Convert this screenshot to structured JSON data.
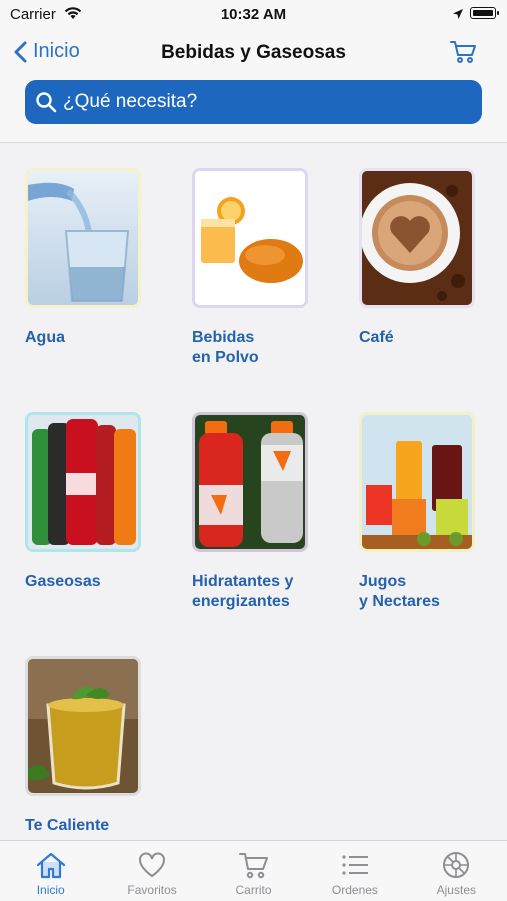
{
  "status_bar": {
    "carrier": "Carrier",
    "time": "10:32 AM"
  },
  "nav": {
    "back_label": "Inicio",
    "title": "Bebidas y Gaseosas"
  },
  "search": {
    "placeholder": "¿Qué necesita?"
  },
  "categories": [
    {
      "line1": "Agua",
      "line2": ""
    },
    {
      "line1": "Bebidas",
      "line2": "en Polvo"
    },
    {
      "line1": "Café",
      "line2": ""
    },
    {
      "line1": "Gaseosas",
      "line2": ""
    },
    {
      "line1": "Hidratantes y",
      "line2": "energizantes"
    },
    {
      "line1": "Jugos",
      "line2": "y Nectares"
    },
    {
      "line1": "Te Caliente",
      "line2": ""
    }
  ],
  "tabbar": {
    "tabs": [
      {
        "label": "Inicio",
        "icon": "home-icon",
        "active": true
      },
      {
        "label": "Favoritos",
        "icon": "heart-icon",
        "active": false
      },
      {
        "label": "Carrito",
        "icon": "cart-icon",
        "active": false
      },
      {
        "label": "Ordenes",
        "icon": "list-icon",
        "active": false
      },
      {
        "label": "Ajustes",
        "icon": "settings-icon",
        "active": false
      }
    ]
  },
  "colors": {
    "accent": "#1e67be",
    "link": "#2f72c4",
    "label": "#2562ad",
    "tab_active": "#2f7ad6",
    "tab_inactive": "#8e8e93"
  }
}
